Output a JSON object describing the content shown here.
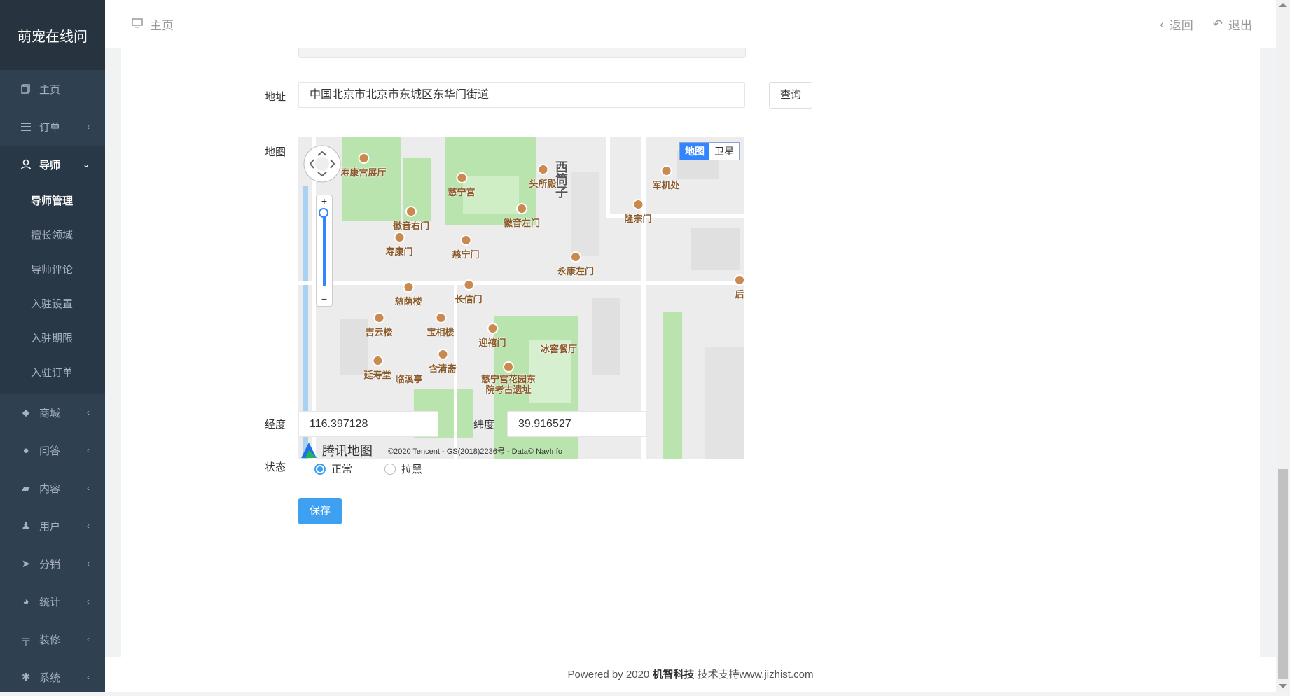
{
  "app": {
    "title": "萌宠在线问"
  },
  "sidebar": {
    "items": [
      {
        "label": "主页",
        "icon": "copy-icon"
      },
      {
        "label": "订单",
        "icon": "list-icon"
      },
      {
        "label": "导师",
        "icon": "user-icon"
      },
      {
        "label": "商城",
        "icon": "tag-icon"
      },
      {
        "label": "问答",
        "icon": "chat-icon"
      },
      {
        "label": "内容",
        "icon": "book-icon"
      },
      {
        "label": "用户",
        "icon": "person-icon"
      },
      {
        "label": "分销",
        "icon": "send-icon"
      },
      {
        "label": "统计",
        "icon": "pie-icon"
      },
      {
        "label": "装修",
        "icon": "hammer-icon"
      },
      {
        "label": "系统",
        "icon": "gear-icon"
      }
    ],
    "submenu": [
      "导师管理",
      "擅长领域",
      "导师评论",
      "入驻设置",
      "入驻期限",
      "入驻订单"
    ]
  },
  "header": {
    "breadcrumb": "主页",
    "back": "返回",
    "logout": "退出"
  },
  "form": {
    "address_label": "地址",
    "address_value": "中国北京市北京市东城区东华门街道",
    "query_button": "查询",
    "map_label": "地图",
    "longitude_label": "经度",
    "longitude_value": "116.397128",
    "latitude_label": "纬度",
    "latitude_value": "39.916527",
    "status_label": "状态",
    "status_options": [
      "正常",
      "拉黑"
    ],
    "status_selected": "正常",
    "save_button": "保存"
  },
  "map": {
    "type_map": "地图",
    "type_satellite": "卫星",
    "brand": "腾讯地图",
    "copyright": "©2020 Tencent - GS(2018)2236号 - Data© NavInfo",
    "pois": [
      "寿康宫展厅",
      "慈宁宫",
      "头所殿",
      "西筒子",
      "军机处",
      "徽音右门",
      "徽音左门",
      "隆宗门",
      "寿康门",
      "慈宁门",
      "永康左门",
      "慈荫楼",
      "长信门",
      "后",
      "吉云楼",
      "宝相楼",
      "迎禧门",
      "冰窖餐厅",
      "含清斋",
      "延寿堂",
      "临溪亭",
      "慈宁宫花园东院考古遗址"
    ]
  },
  "footer": {
    "prefix": "Powered by 2020 ",
    "company": "机智科技",
    "suffix": " 技术支持www.jizhist.com"
  },
  "colors": {
    "sidebar": "#2f4050",
    "primary": "#3ea0f0",
    "map_green": "#b9e4ad"
  }
}
